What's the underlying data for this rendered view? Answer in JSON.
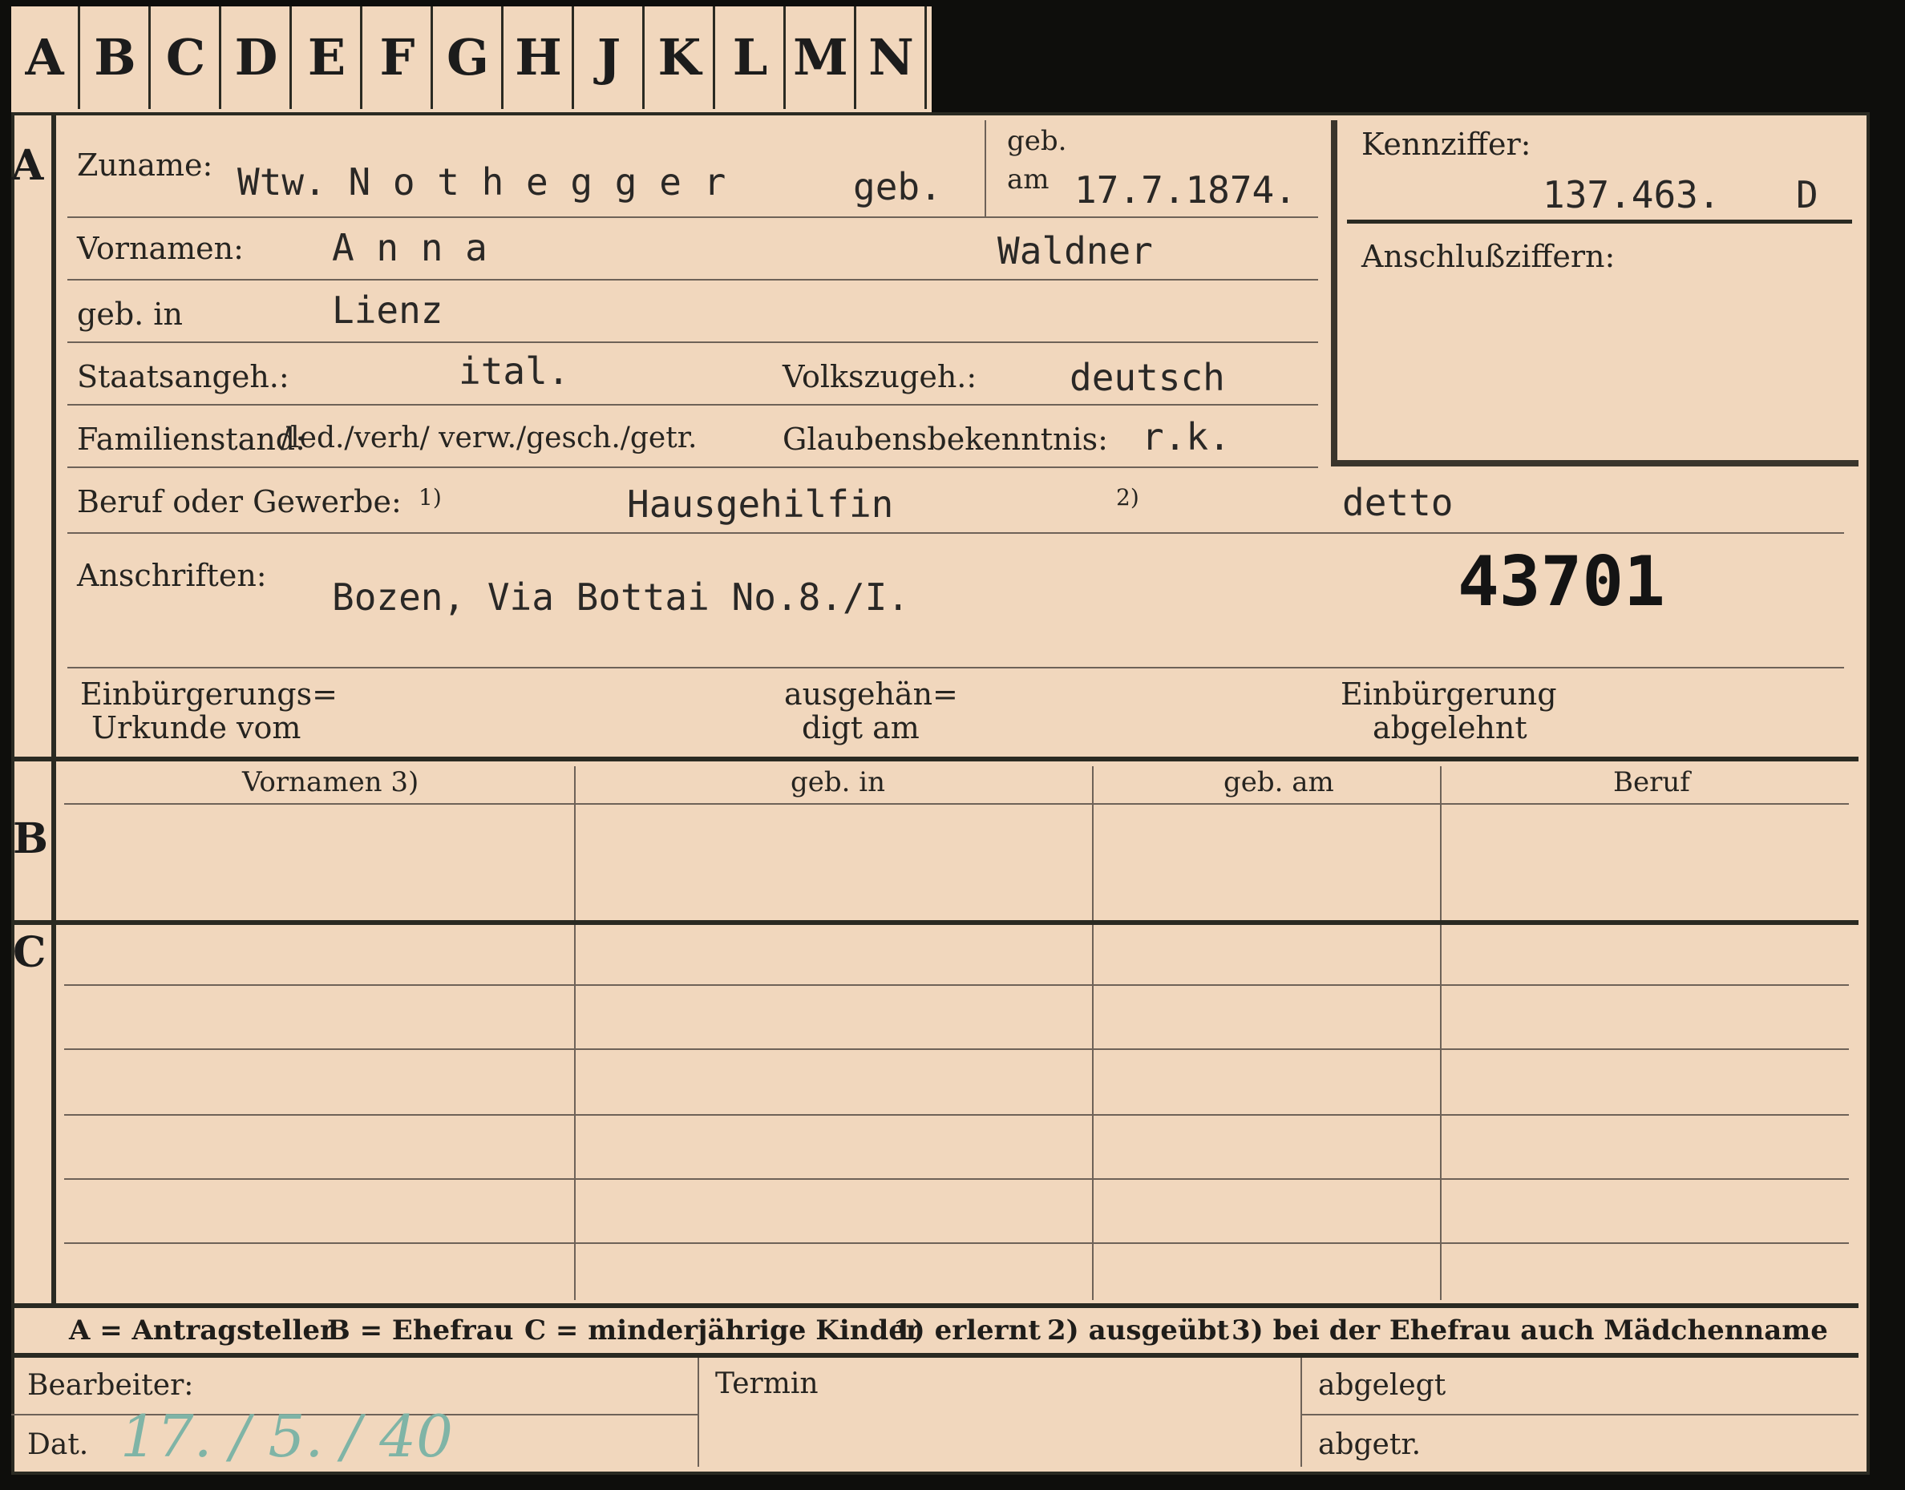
{
  "tabs": [
    "A",
    "B",
    "C",
    "D",
    "E",
    "F",
    "G",
    "H",
    "J",
    "K",
    "L",
    "M",
    "N"
  ],
  "side_labels": {
    "a": "A",
    "b": "B",
    "c": "C"
  },
  "section_a": {
    "zuname_label": "Zuname:",
    "zuname_value": "Wtw. N o t h e g g e r",
    "geb_word": "geb.",
    "geb_label": "geb.",
    "am_label": "am",
    "geb_am_value": "17.7.1874.",
    "vornamen_label": "Vornamen:",
    "vornamen_value": "A n n a",
    "maiden_name": "Waldner",
    "geb_in_label": "geb. in",
    "geb_in_value": "Lienz",
    "staatsangeh_label": "Staatsangeh.:",
    "staatsangeh_value": "ital.",
    "volkszugeh_label": "Volkszugeh.:",
    "volkszugeh_value": "deutsch",
    "familienstand_label": "Familienstand:",
    "familienstand_options": "/led./verh/ verw./gesch./getr.",
    "glauben_label": "Glaubensbekenntnis:",
    "glauben_value": "r.k.",
    "beruf_label": "Beruf oder Gewerbe:",
    "beruf_sup1": "1)",
    "beruf_value": "Hausgehilfin",
    "beruf_sup2": "2)",
    "beruf_value2": "detto",
    "anschriften_label": "Anschriften:",
    "anschriften_value": "Bozen,  Via Bottai No.8./I.",
    "stamp_number": "43701",
    "einb_label_1": "Einbürgerungs=",
    "einb_label_2": "Urkunde vom",
    "ausgeh_label_1": "ausgehän=",
    "ausgeh_label_2": "digt am",
    "abgelehnt_label_1": "Einbürgerung",
    "abgelehnt_label_2": "abgelehnt"
  },
  "kennziffer": {
    "label": "Kennziffer:",
    "value": "137.463.",
    "suffix": "D",
    "anschluss_label": "Anschlußziffern:"
  },
  "section_b": {
    "columns": [
      "Vornamen 3)",
      "geb. in",
      "geb. am",
      "Beruf"
    ]
  },
  "legend": {
    "a": "A = Antragsteller",
    "b": "B = Ehefrau",
    "c": "C = minderjährige Kinder",
    "n1": "1) erlernt",
    "n2": "2) ausgeübt",
    "n3": "3) bei der Ehefrau auch Mädchenname"
  },
  "footer": {
    "bearbeiter_label": "Bearbeiter:",
    "dat_label": "Dat.",
    "dat_value": "17. / 5. / 40",
    "termin_label": "Termin",
    "abgelegt_label": "abgelegt",
    "abgetr_label": "abgetr."
  },
  "colors": {
    "paper": "#f1d7bd",
    "ink": "#2a2826",
    "pencil": "#7fb4a6"
  }
}
